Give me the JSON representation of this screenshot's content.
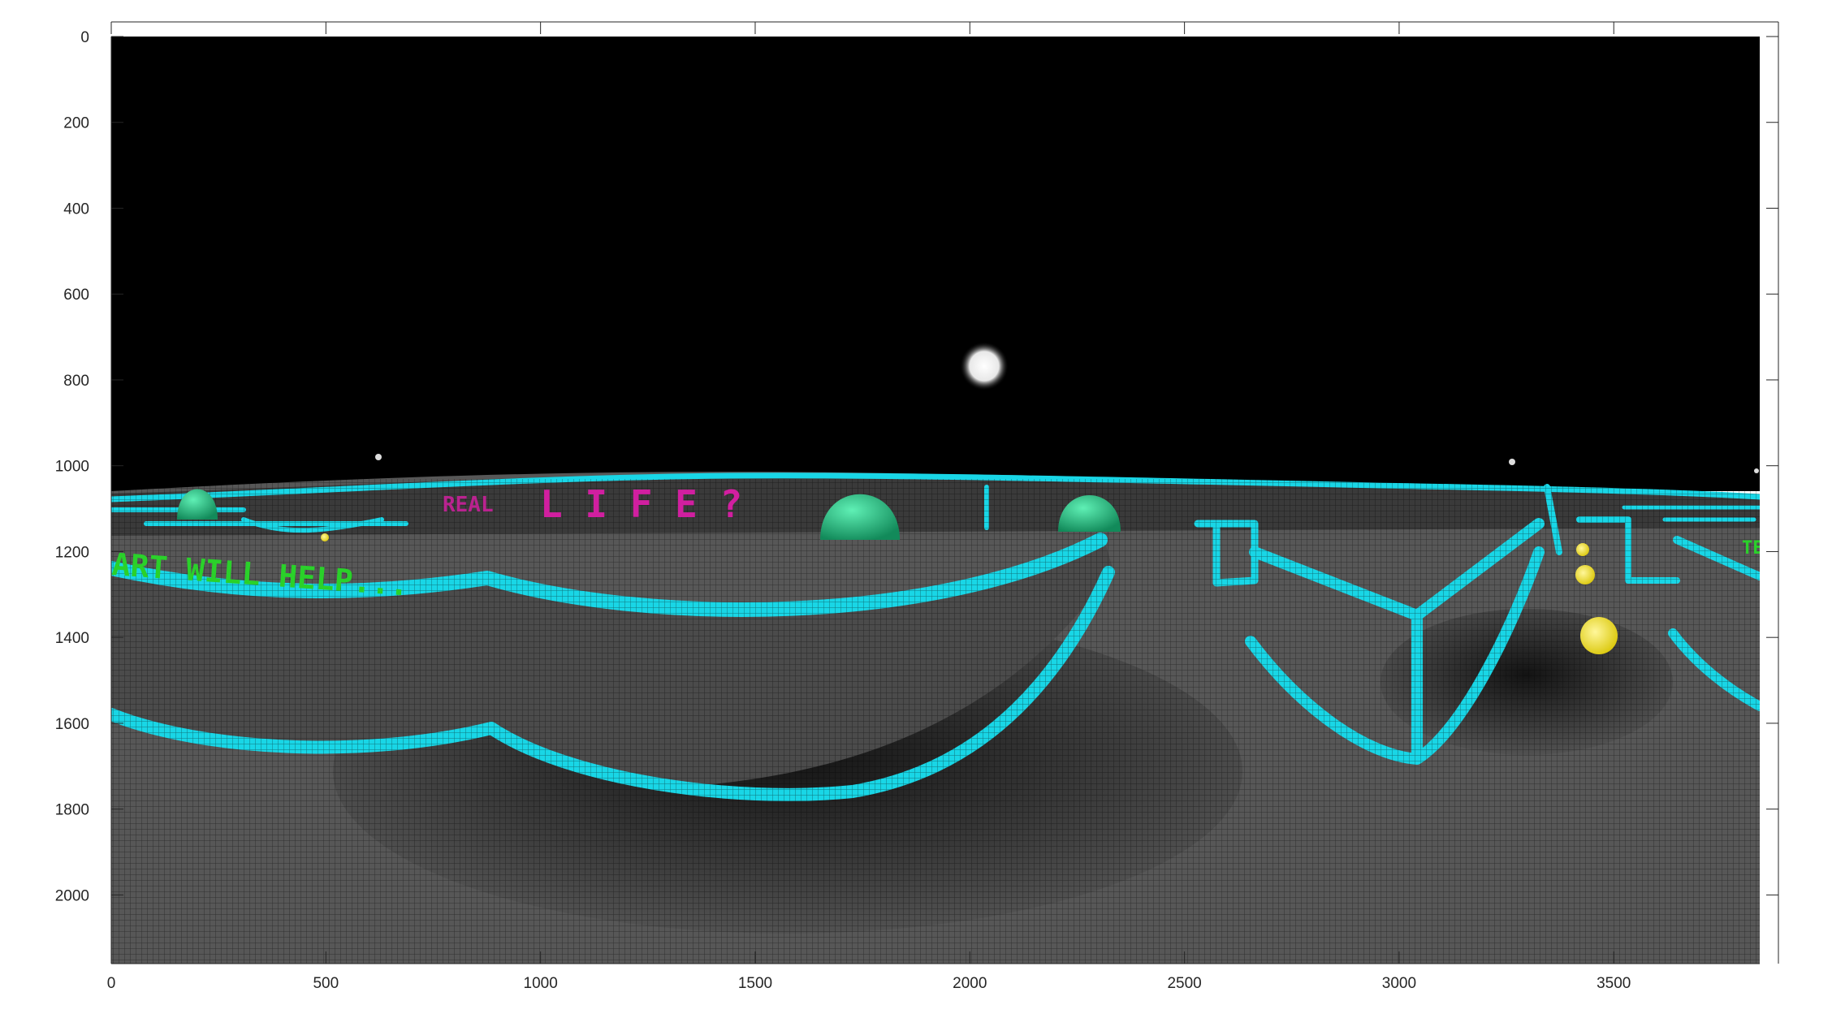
{
  "figure": {
    "x_ticks": [
      "0",
      "500",
      "1000",
      "1500",
      "2000",
      "2500",
      "3000",
      "3500"
    ],
    "y_ticks": [
      "0",
      "200",
      "400",
      "600",
      "800",
      "1000",
      "1200",
      "1400",
      "1600",
      "1800",
      "2000"
    ]
  },
  "scene": {
    "sign_life": "L I F E ?",
    "sign_real": "REAL",
    "sign_help": "ART WILL HELP...",
    "sign_right": "TE",
    "colors": {
      "sky": "#000000",
      "floor": "#555555",
      "neon": "#19d6e6",
      "magenta_text": "#d11fa0",
      "green_text": "#2ad12a",
      "dome": "#24c787",
      "orb": "#f2e31a"
    }
  }
}
